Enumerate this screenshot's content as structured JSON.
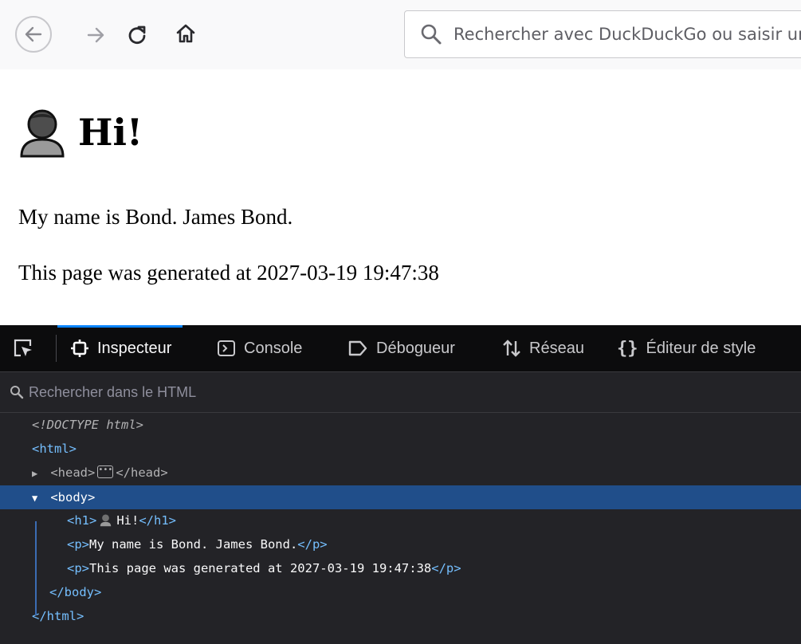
{
  "browser": {
    "search": {
      "placeholder": "Rechercher avec DuckDuckGo ou saisir une adresse"
    }
  },
  "page": {
    "heading": "Hi!",
    "paragraph_name": "My name is Bond. James Bond.",
    "paragraph_time": "This page was generated at 2027-03-19 19:47:38"
  },
  "devtools": {
    "tabs": {
      "inspecteur": "Inspecteur",
      "console": "Console",
      "debogueur": "Débogueur",
      "reseau": "Réseau",
      "style": "Éditeur de style"
    },
    "search_placeholder": "Rechercher dans le HTML",
    "markup": {
      "doctype": "<!DOCTYPE html>",
      "html_open": "<html>",
      "head_open": "<head>",
      "head_close": "</head>",
      "body_open": "<body>",
      "h1_open": "<h1>",
      "h1_text": "Hi!",
      "h1_close": "</h1>",
      "p_open": "<p>",
      "p1_text": "My name is Bond. James Bond.",
      "p_close": "</p>",
      "p2_text": "This page was generated at 2027-03-19 19:47:38",
      "body_close": "</body>",
      "html_close": "</html>"
    }
  },
  "colors": {
    "selection": "#204e8a",
    "tag": "#75bfff",
    "accent": "#0a84ff"
  },
  "icons": {
    "back": "back-arrow-icon",
    "forward": "forward-arrow-icon",
    "reload": "reload-icon",
    "home": "home-icon",
    "search": "search-icon",
    "person": "person-icon"
  }
}
